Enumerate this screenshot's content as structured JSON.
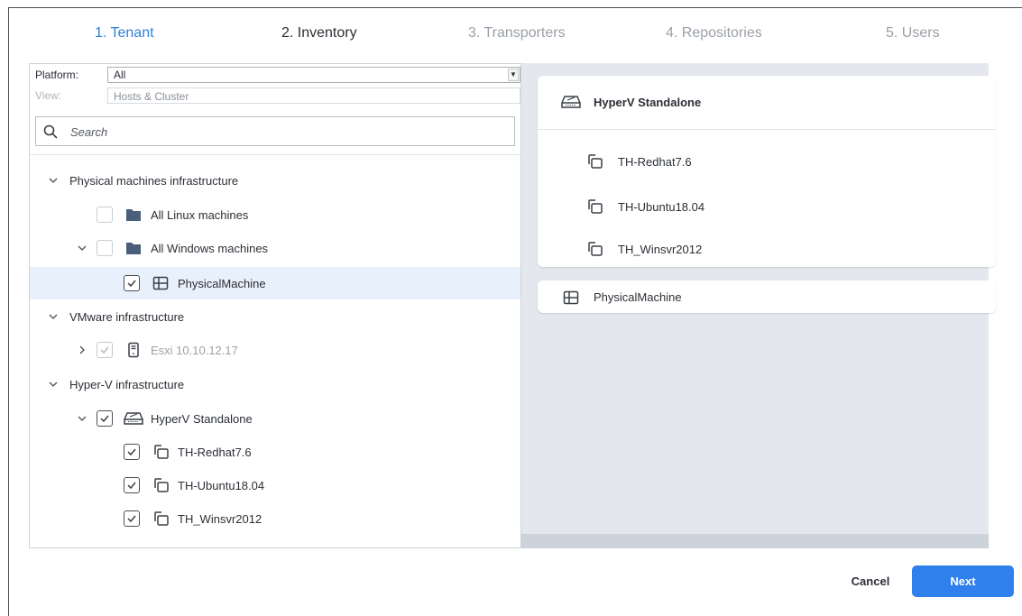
{
  "steps": [
    {
      "label": "1. Tenant",
      "state": "done"
    },
    {
      "label": "2. Inventory",
      "state": "active"
    },
    {
      "label": "3. Transporters",
      "state": "todo"
    },
    {
      "label": "4. Repositories",
      "state": "todo"
    },
    {
      "label": "5. Users",
      "state": "todo"
    }
  ],
  "filters": {
    "platform_label": "Platform:",
    "platform_value": "All",
    "view_label": "View:",
    "view_value": "Hosts & Cluster"
  },
  "search": {
    "placeholder": "Search",
    "icon": "search-icon"
  },
  "tree": {
    "physical_group": "Physical machines infrastructure",
    "all_linux": "All Linux machines",
    "all_windows": "All Windows machines",
    "physical_machine": "PhysicalMachine",
    "vmware_group": "VMware infrastructure",
    "esxi": "Esxi 10.10.12.17",
    "hyperv_group": "Hyper-V infrastructure",
    "hyperv_standalone": "HyperV Standalone",
    "vm1": "TH-Redhat7.6",
    "vm2": "TH-Ubuntu18.04",
    "vm3": "TH_Winsvr2012"
  },
  "selection": {
    "host_title": "HyperV Standalone",
    "vms": [
      "TH-Redhat7.6",
      "TH-Ubuntu18.04",
      "TH_Winsvr2012"
    ],
    "physical": "PhysicalMachine"
  },
  "buttons": {
    "cancel": "Cancel",
    "next": "Next"
  },
  "colors": {
    "accent": "#2f80ed",
    "step_done": "#2f7fd8",
    "selected_row": "#e8f0fb",
    "folder": "#4a5f7a"
  }
}
